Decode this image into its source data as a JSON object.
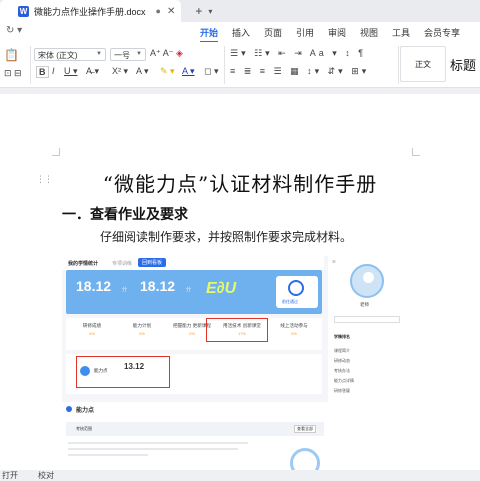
{
  "titlebar": {
    "doc_name": "微能力点作业操作手册.docx",
    "word_letter": "W"
  },
  "menu": {
    "items": [
      "开始",
      "插入",
      "页面",
      "引用",
      "审阅",
      "视图",
      "工具",
      "会员专享"
    ],
    "active": "开始"
  },
  "ribbon": {
    "font_name": "宋体 (正文)",
    "font_size": "一号",
    "style_normal": "正文",
    "style_heading": "标题"
  },
  "doc": {
    "title": "“微能力点”认证材料制作手册",
    "heading1": "一．查看作业及要求",
    "paragraph": "仔细阅读制作要求，并按照制作要求完成材料。"
  },
  "shot": {
    "top_title": "我的学情统计",
    "top_tab1": "专项训练",
    "top_btn": "回到看板",
    "banner_num1": "18.12",
    "banner_unit1": "分",
    "banner_num2": "18.12",
    "banner_unit2": "分",
    "banner_side": "前往通过",
    "stats": [
      "研修成绩",
      "能力计划",
      "把握能力 更新课程",
      "用活技术 创新课堂",
      "线上活动参与"
    ],
    "stat_values": [
      "0%",
      "0%",
      "0%",
      "17%",
      "0%"
    ],
    "ability_label": "能力点",
    "ability_value": "13.12",
    "big_title": "能力点",
    "big_tab": "考核范围",
    "big_btn": "查看全部",
    "side_name": "老师",
    "side_items": [
      "学情排名",
      "课程简介",
      "研修动态",
      "考核办法",
      "能力点详情",
      "研修答疑"
    ]
  },
  "status": {
    "left": "打开",
    "mid": "校对"
  }
}
